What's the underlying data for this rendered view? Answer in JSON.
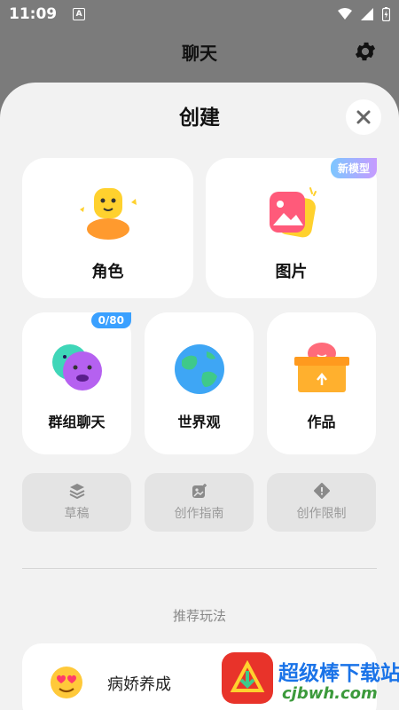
{
  "status_bar": {
    "time": "11:09",
    "indicator": "A"
  },
  "header": {
    "title": "聊天",
    "settings_icon": "gear-icon"
  },
  "sheet": {
    "title": "创建",
    "close_icon": "close-icon"
  },
  "cards": {
    "character": {
      "label": "角色",
      "icon": "character-face-icon"
    },
    "image": {
      "label": "图片",
      "icon": "picture-icon",
      "badge": "新模型"
    },
    "group_chat": {
      "label": "群组聊天",
      "icon": "chat-bubbles-icon",
      "badge": "0/80"
    },
    "worldview": {
      "label": "世界观",
      "icon": "globe-icon"
    },
    "works": {
      "label": "作品",
      "icon": "box-icon"
    }
  },
  "tools": {
    "drafts": {
      "label": "草稿",
      "icon": "layers-icon"
    },
    "guide": {
      "label": "创作指南",
      "icon": "guide-icon"
    },
    "limits": {
      "label": "创作限制",
      "icon": "warning-icon"
    }
  },
  "recommend": {
    "title": "推荐玩法",
    "items": [
      {
        "label": "病娇养成",
        "icon": "heart-eyes-emoji-icon"
      }
    ]
  },
  "watermark": {
    "name": "超级棒下载站",
    "url": "cjbwh.com"
  }
}
